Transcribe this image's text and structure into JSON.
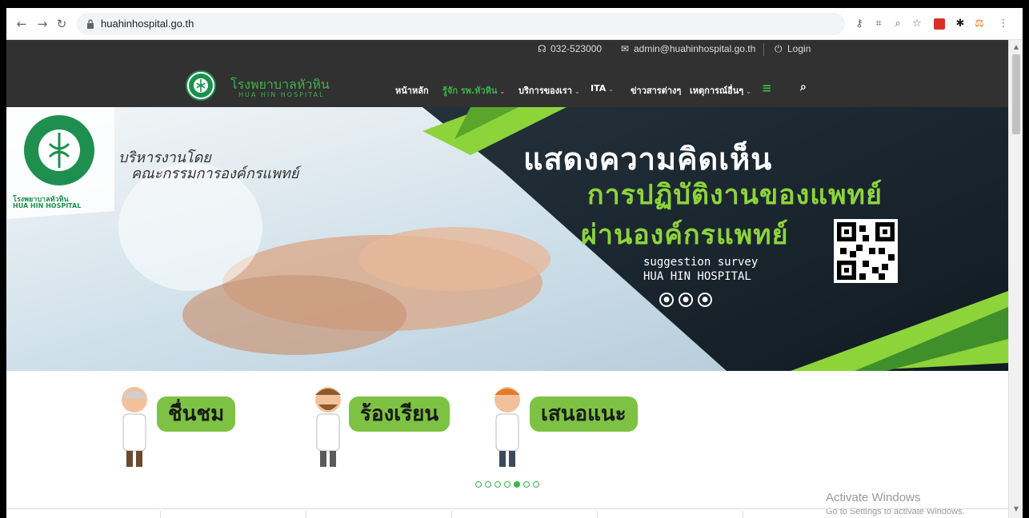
{
  "browser": {
    "url": "huahinhospital.go.th",
    "back_icon": "back-arrow-icon",
    "forward_icon": "forward-arrow-icon",
    "reload_icon": "reload-icon"
  },
  "topbar": {
    "phone": "032-523000",
    "email": "admin@huahinhospital.go.th",
    "login": "Login"
  },
  "logo": {
    "name_th": "โรงพยาบาลหัวหิน",
    "name_en": "HUA HIN HOSPITAL"
  },
  "menu": {
    "items": [
      {
        "label": "หน้าหลัก"
      },
      {
        "label": "รู้จัก รพ.หัวหิน"
      },
      {
        "label": "บริการของเรา"
      },
      {
        "label": "ITA"
      },
      {
        "label": "ข่าวสารต่างๆ"
      },
      {
        "label": "เหตุการณ์อื่นๆ"
      }
    ]
  },
  "banner": {
    "headline_1": "แสดงความคิดเห็น",
    "headline_2": "การปฏิบัติงานของแพทย์",
    "headline_3": "ผ่านองค์กรแพทย์",
    "sub_1": "suggestion  survey",
    "sub_2": "HUA  HIN  HOSPITAL",
    "script_1": "บริหารงานโดย",
    "script_2": "คณะกรรมการองค์กรแพทย์",
    "hosp_th": "โรงพยาบาลหัวหิน",
    "hosp_en": "HUA HIN HOSPITAL"
  },
  "cards": [
    {
      "label": "ชื่นชม"
    },
    {
      "label": "ร้องเรียน"
    },
    {
      "label": "เสนอแนะ"
    }
  ],
  "carousel": {
    "count": 7,
    "active": 5
  },
  "watermark": {
    "title": "Activate Windows",
    "subtitle": "Go to Settings to activate Windows."
  },
  "colors": {
    "brand_green": "#3bb54a",
    "header_bg": "#313131",
    "banner_dark": "#1a2733",
    "accent_lime": "#8dd43a"
  }
}
